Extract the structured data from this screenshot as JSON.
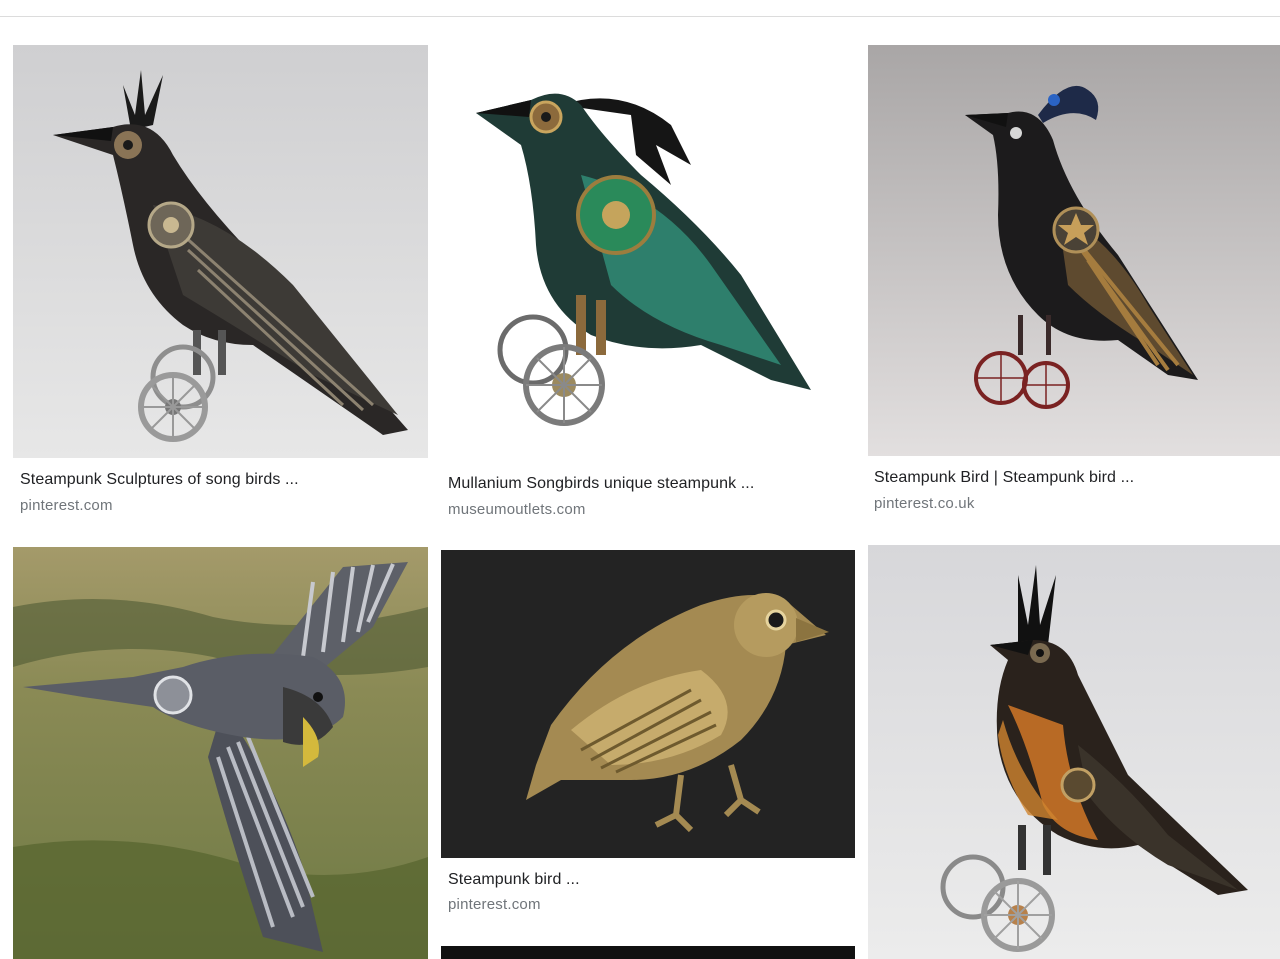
{
  "results": [
    {
      "title": "Steampunk Sculptures of song birds ...",
      "source": "pinterest.com"
    },
    {
      "title": "Mullanium Songbirds unique steampunk ...",
      "source": "museumoutlets.com"
    },
    {
      "title": "Steampunk Bird | Steampunk bird ...",
      "source": "pinterest.co.uk"
    },
    {
      "title": "",
      "source": ""
    },
    {
      "title": "Steampunk bird ...",
      "source": "pinterest.com"
    },
    {
      "title": "",
      "source": ""
    }
  ]
}
